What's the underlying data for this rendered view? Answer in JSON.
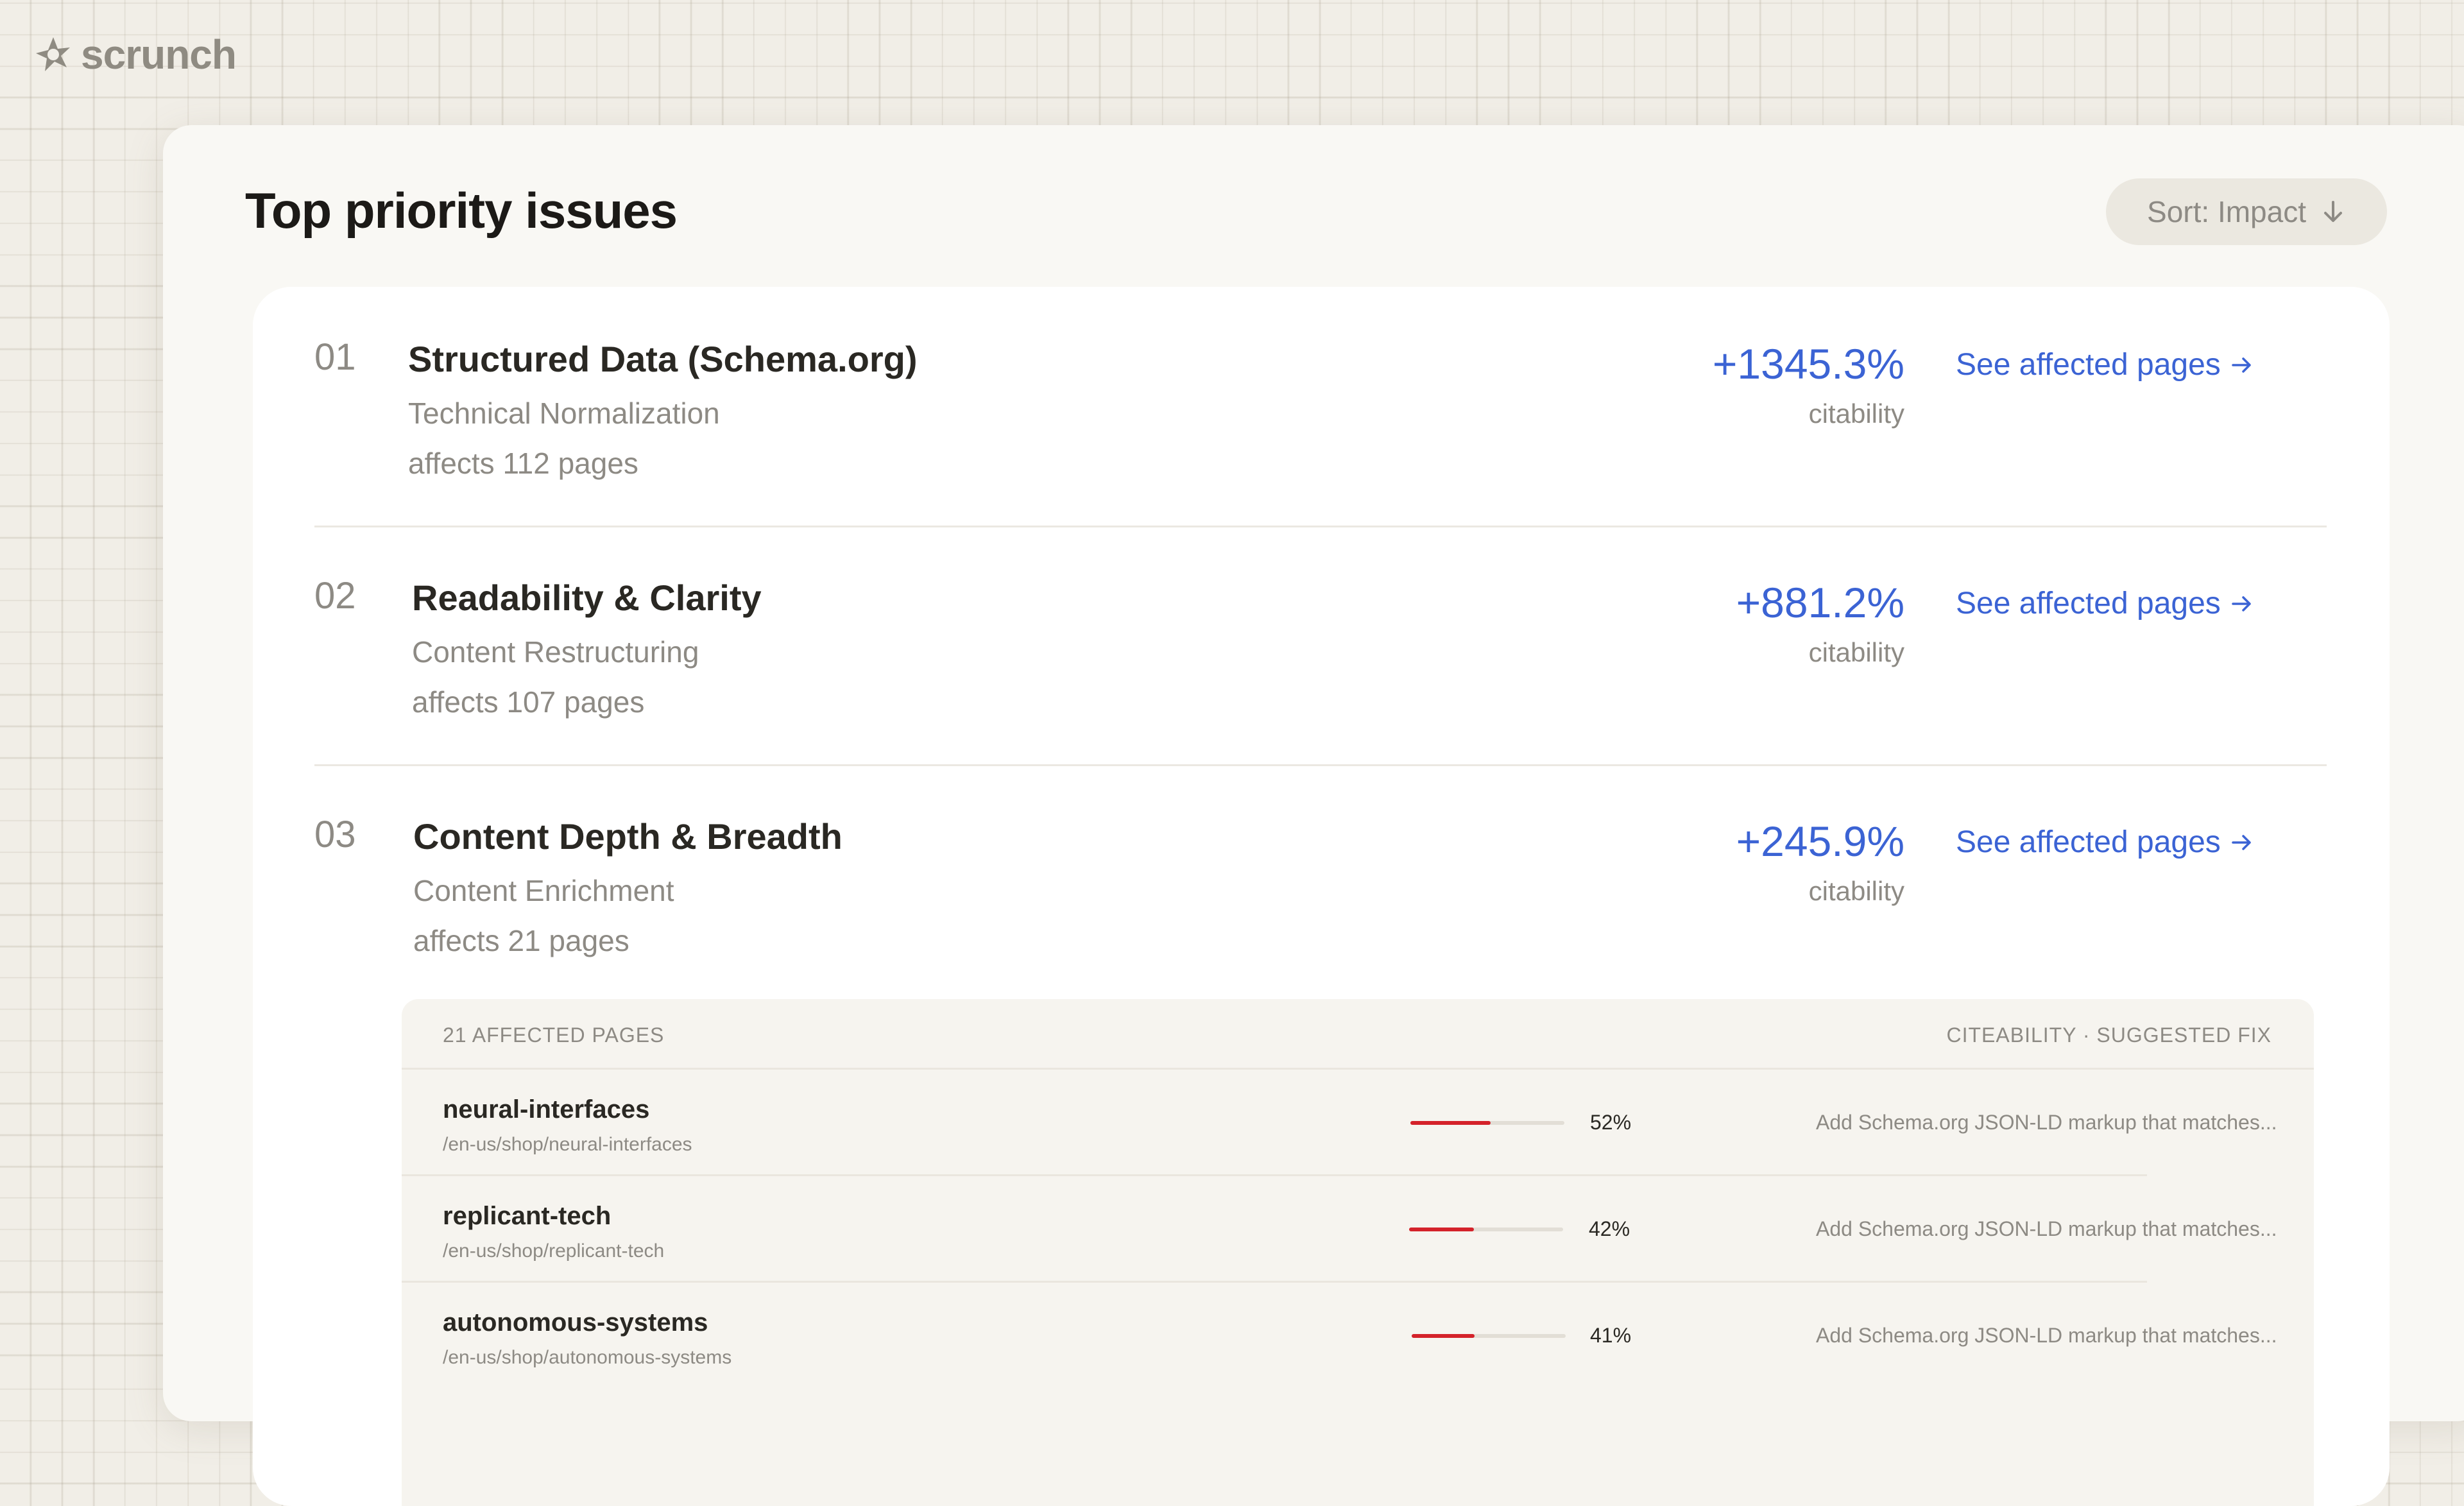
{
  "brand": {
    "name": "scrunch"
  },
  "panel": {
    "title": "Top priority issues",
    "sort_label": "Sort: Impact",
    "sort_icon": "arrow-down-icon"
  },
  "issues": [
    {
      "number": "01",
      "title": "Structured Data (Schema.org)",
      "category": "Technical Normalization",
      "affects": "affects 112 pages",
      "metric_value": "+1345.3%",
      "metric_label": "citability",
      "link_label": "See affected pages"
    },
    {
      "number": "02",
      "title": "Readability & Clarity",
      "category": "Content Restructuring",
      "affects": "affects 107 pages",
      "metric_value": "+881.2%",
      "metric_label": "citability",
      "link_label": "See affected pages"
    },
    {
      "number": "03",
      "title": "Content Depth & Breadth",
      "category": "Content Enrichment",
      "affects": "affects 21 pages",
      "metric_value": "+245.9%",
      "metric_label": "citability",
      "link_label": "See affected pages"
    }
  ],
  "affected": {
    "count_label": "21 AFFECTED PAGES",
    "columns_label": "CITEABILITY · SUGGESTED FIX",
    "bar_color": "#d4222a",
    "pages": [
      {
        "slug": "neural-interfaces",
        "path": "/en-us/shop/neural-interfaces",
        "citeability": 52,
        "citeability_label": "52%",
        "fix": "Add Schema.org JSON-LD markup that matches..."
      },
      {
        "slug": "replicant-tech",
        "path": "/en-us/shop/replicant-tech",
        "citeability": 42,
        "citeability_label": "42%",
        "fix": "Add Schema.org JSON-LD markup that matches..."
      },
      {
        "slug": "autonomous-systems",
        "path": "/en-us/shop/autonomous-systems",
        "citeability": 41,
        "citeability_label": "41%",
        "fix": "Add Schema.org JSON-LD markup that matches..."
      }
    ]
  }
}
